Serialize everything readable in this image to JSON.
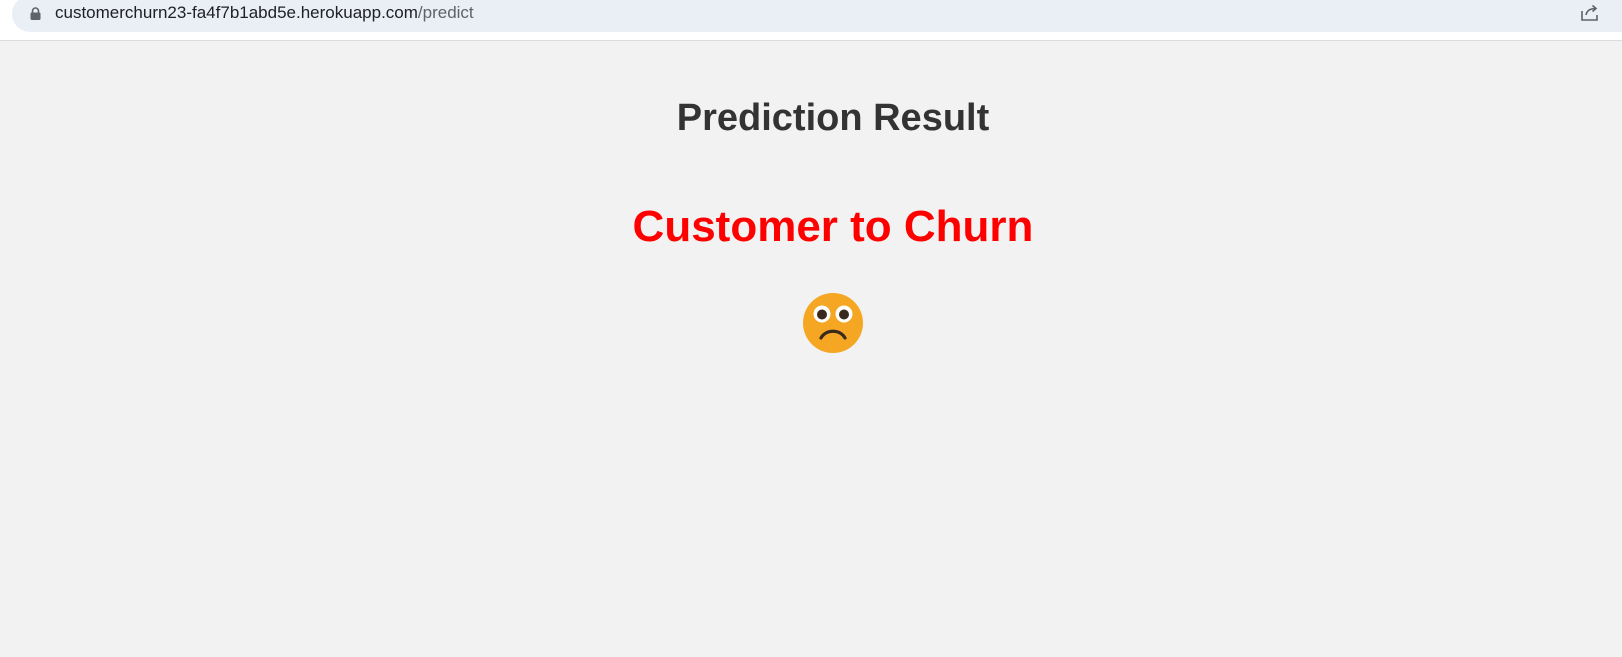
{
  "browser": {
    "url_host": "customerchurn23-fa4f7b1abd5e.herokuapp.com",
    "url_path": "/predict"
  },
  "page": {
    "title": "Prediction Result",
    "result_text": "Customer to Churn",
    "result_color": "#ff0000",
    "result_icon": "sad-face-icon"
  }
}
